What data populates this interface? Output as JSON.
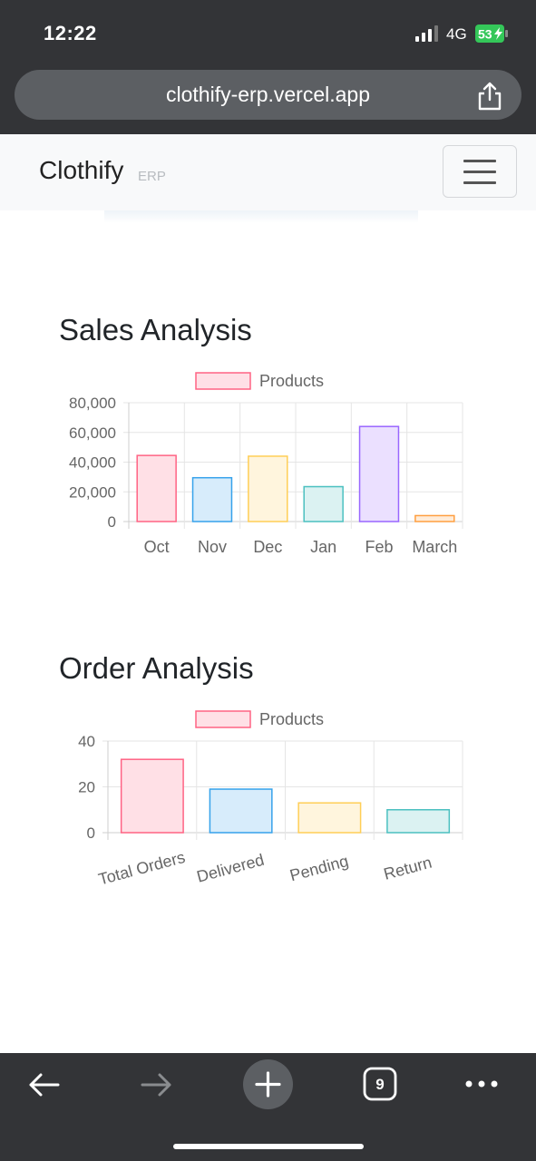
{
  "status": {
    "time": "12:22",
    "network": "4G",
    "battery": "53"
  },
  "browser": {
    "url": "clothify-erp.vercel.app",
    "tab_count": "9"
  },
  "navbar": {
    "brand": "Clothify",
    "brand_sub": "ERP"
  },
  "sales": {
    "title": "Sales Analysis"
  },
  "orders": {
    "title": "Order Analysis"
  },
  "chart_data": [
    {
      "type": "bar",
      "categories": [
        "Oct",
        "Nov",
        "Dec",
        "Jan",
        "Feb",
        "March"
      ],
      "series": [
        {
          "name": "Products",
          "values": [
            44500,
            29500,
            44000,
            23500,
            64000,
            4000
          ]
        }
      ],
      "ylim": [
        0,
        80000
      ],
      "yticks": [
        "80,000",
        "60,000",
        "40,000",
        "20,000",
        "0"
      ],
      "legend": "top",
      "grid": true
    },
    {
      "type": "bar",
      "categories": [
        "Total Orders",
        "Delivered",
        "Pending",
        "Return"
      ],
      "series": [
        {
          "name": "Products",
          "values": [
            32,
            19,
            13,
            10
          ]
        }
      ],
      "ylim": [
        0,
        40
      ],
      "yticks": [
        "40",
        "20",
        "0"
      ],
      "legend": "top",
      "grid": true
    }
  ],
  "colors": {
    "bar_fills": [
      "#ffe0e6",
      "#d7ecfb",
      "#fff5dd",
      "#dbf2f2",
      "#ebe0ff",
      "#ffecd9"
    ],
    "bar_strokes": [
      "#ff6384",
      "#36a2eb",
      "#ffce56",
      "#4bc0c0",
      "#9966ff",
      "#ff9f40"
    ]
  }
}
